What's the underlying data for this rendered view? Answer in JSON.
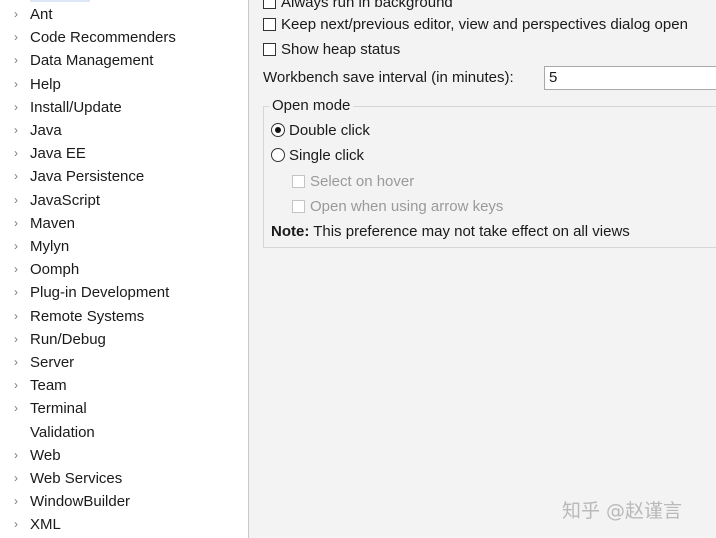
{
  "sidebar": {
    "items": [
      {
        "label": "Ant",
        "expandable": true
      },
      {
        "label": "Code Recommenders",
        "expandable": true
      },
      {
        "label": "Data Management",
        "expandable": true
      },
      {
        "label": "Help",
        "expandable": true
      },
      {
        "label": "Install/Update",
        "expandable": true
      },
      {
        "label": "Java",
        "expandable": true
      },
      {
        "label": "Java EE",
        "expandable": true
      },
      {
        "label": "Java Persistence",
        "expandable": true
      },
      {
        "label": "JavaScript",
        "expandable": true
      },
      {
        "label": "Maven",
        "expandable": true
      },
      {
        "label": "Mylyn",
        "expandable": true
      },
      {
        "label": "Oomph",
        "expandable": true
      },
      {
        "label": "Plug-in Development",
        "expandable": true
      },
      {
        "label": "Remote Systems",
        "expandable": true
      },
      {
        "label": "Run/Debug",
        "expandable": true
      },
      {
        "label": "Server",
        "expandable": true
      },
      {
        "label": "Team",
        "expandable": true
      },
      {
        "label": "Terminal",
        "expandable": true
      },
      {
        "label": "Validation",
        "expandable": false
      },
      {
        "label": "Web",
        "expandable": true
      },
      {
        "label": "Web Services",
        "expandable": true
      },
      {
        "label": "WindowBuilder",
        "expandable": true
      },
      {
        "label": "XML",
        "expandable": true
      }
    ],
    "chevron_glyph": "›"
  },
  "main": {
    "always_run_background": {
      "label": "Always run in background",
      "checked": false
    },
    "keep_next_prev": {
      "label": "Keep next/previous editor, view and perspectives dialog open",
      "checked": false
    },
    "show_heap": {
      "label": "Show heap status",
      "checked": false
    },
    "save_interval": {
      "label": "Workbench save interval (in minutes):",
      "value": "5"
    },
    "open_mode": {
      "title": "Open mode",
      "double_click": {
        "label": "Double click",
        "selected": true
      },
      "single_click": {
        "label": "Single click",
        "selected": false
      },
      "select_on_hover": {
        "label": "Select on hover",
        "enabled": false
      },
      "open_arrow_keys": {
        "label": "Open when using arrow keys",
        "enabled": false
      },
      "note_bold": "Note:",
      "note_text": " This preference may not take effect on all views"
    }
  },
  "watermark": "知乎 @赵谨言"
}
